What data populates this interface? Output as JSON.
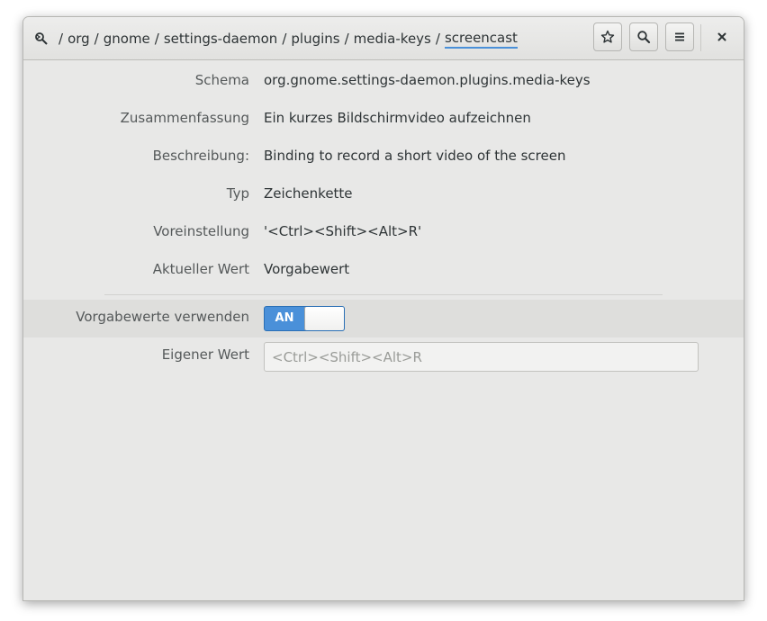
{
  "header": {
    "breadcrumb": [
      "org",
      "gnome",
      "settings-daemon",
      "plugins",
      "media-keys",
      "screencast"
    ],
    "separator": "/",
    "buttons": {
      "bookmark_icon": "star-icon",
      "search_icon": "search-icon",
      "menu_icon": "hamburger-menu-icon",
      "close_icon": "close-icon"
    }
  },
  "details": {
    "schema_label": "Schema",
    "schema_value": "org.gnome.settings-daemon.plugins.media-keys",
    "summary_label": "Zusammenfassung",
    "summary_value": "Ein kurzes Bildschirmvideo aufzeichnen",
    "description_label": "Beschreibung:",
    "description_value": "Binding to record a short video of the screen",
    "type_label": "Typ",
    "type_value": "Zeichenkette",
    "default_label": "Voreinstellung",
    "default_value": "'<Ctrl><Shift><Alt>R'",
    "current_label": "Aktueller Wert",
    "current_value": "Vorgabewert"
  },
  "settings": {
    "use_default_label": "Vorgabewerte verwenden",
    "use_default_switch": "AN",
    "use_default_on": true,
    "custom_value_label": "Eigener Wert",
    "custom_value_placeholder": "<Ctrl><Shift><Alt>R",
    "custom_value": ""
  },
  "colors": {
    "accent": "#4a90d9",
    "window_bg": "#e8e8e7"
  }
}
